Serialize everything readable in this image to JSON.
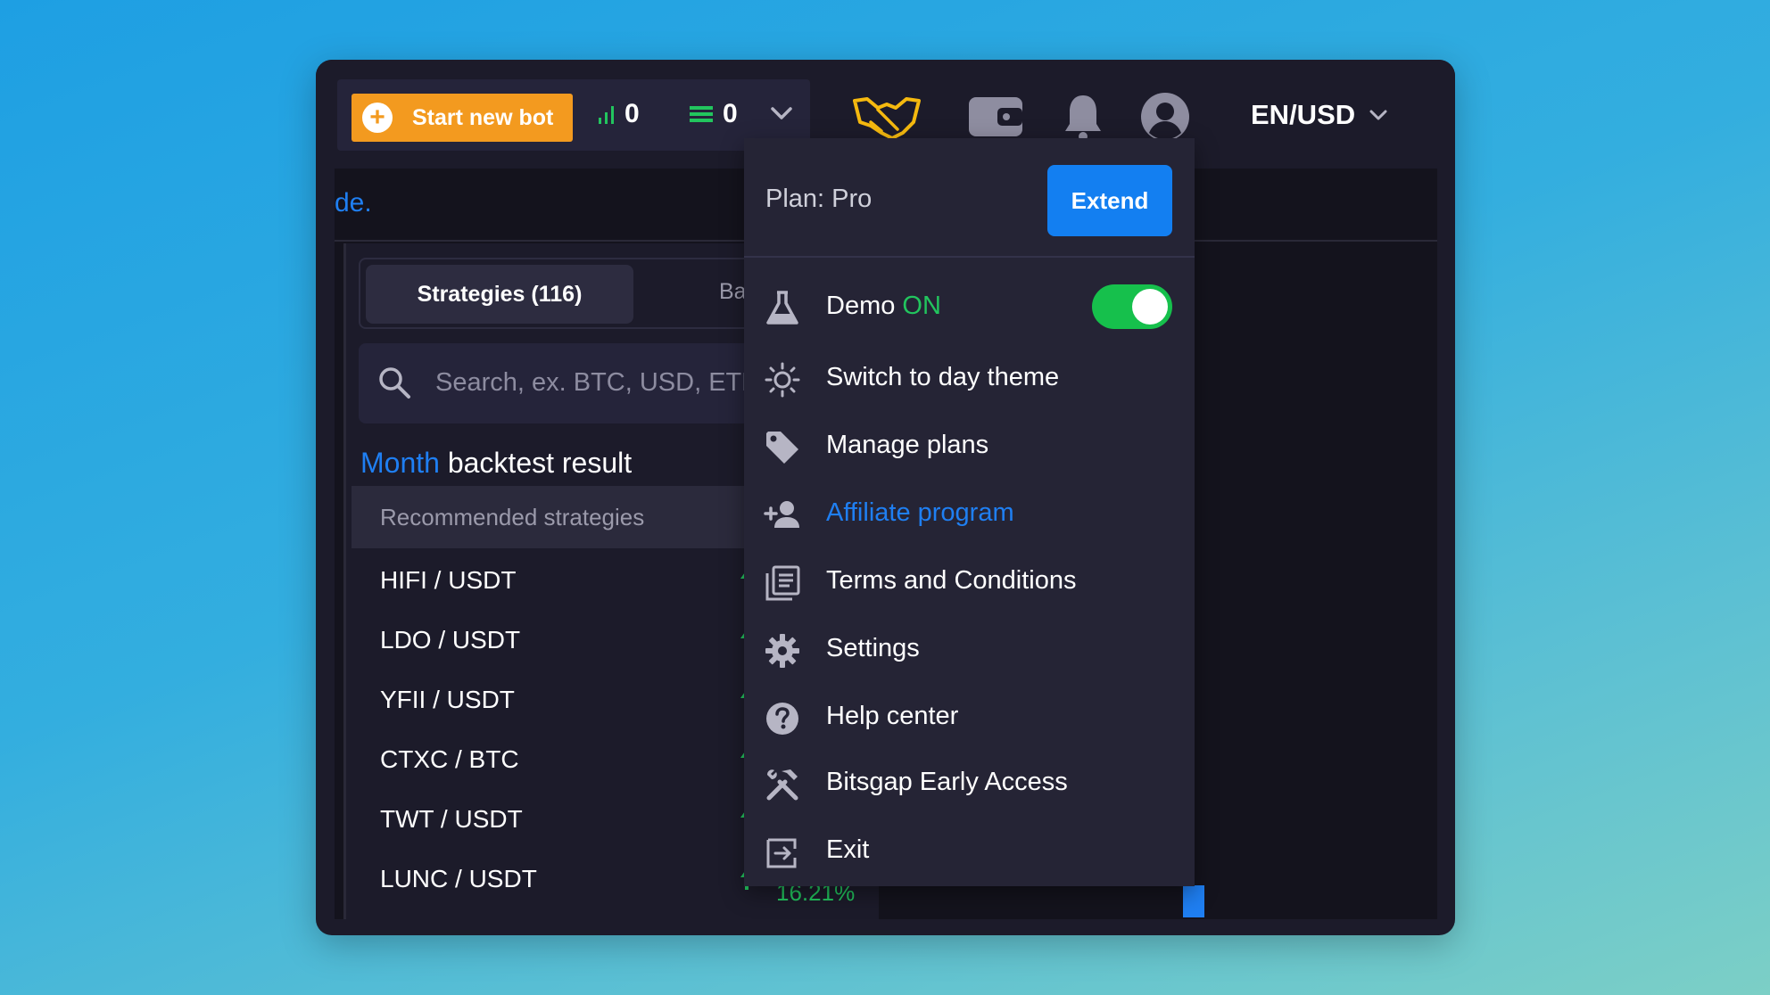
{
  "topbar": {
    "start_bot_label": "Start new bot",
    "active_bots_count": "0",
    "orders_count": "0",
    "language_currency": "EN/USD"
  },
  "notice": {
    "text": "de."
  },
  "strategies": {
    "tab_active": "Strategies (116)",
    "tab_inactive": "Ba",
    "search_placeholder": "Search, ex. BTC, USD, ETH",
    "period": "Month",
    "result_label": "backtest result",
    "recommended_header": "Recommended strategies",
    "pairs": [
      {
        "name": "HIFI / USDT"
      },
      {
        "name": "LDO / USDT"
      },
      {
        "name": "YFII / USDT"
      },
      {
        "name": "CTXC / BTC"
      },
      {
        "name": "TWT / USDT"
      },
      {
        "name": "LUNC / USDT",
        "value": "16.21%"
      }
    ]
  },
  "dropdown": {
    "plan_label": "Plan: Pro",
    "extend_label": "Extend",
    "demo_label": "Demo",
    "demo_state": "ON",
    "demo_enabled": true,
    "items": [
      {
        "label": "Switch to day theme",
        "icon": "sun-icon"
      },
      {
        "label": "Manage plans",
        "icon": "tag-icon"
      },
      {
        "label": "Affiliate program",
        "icon": "add-user-icon"
      },
      {
        "label": "Terms and Conditions",
        "icon": "document-icon"
      },
      {
        "label": "Settings",
        "icon": "gear-icon"
      },
      {
        "label": "Help center",
        "icon": "question-icon"
      },
      {
        "label": "Bitsgap Early Access",
        "icon": "tools-icon"
      },
      {
        "label": "Exit",
        "icon": "exit-icon"
      }
    ]
  },
  "colors": {
    "accent_orange": "#f39a1f",
    "accent_blue": "#1f7ff2",
    "success_green": "#22c55e",
    "panel_bg": "#1c1b2a",
    "dropdown_bg": "#252435"
  }
}
